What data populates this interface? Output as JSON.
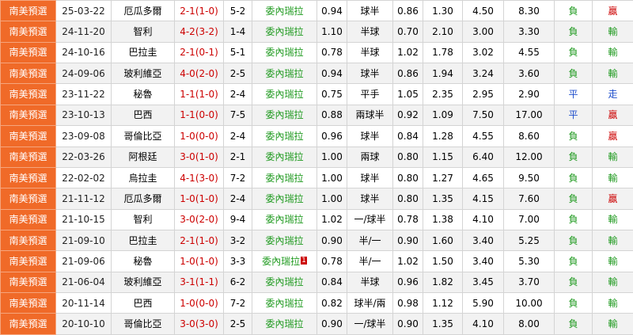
{
  "colors": {
    "league_bg": "#f06a28",
    "score": "#cc0000",
    "venezuela": "#1f9a1f",
    "win": "#cc0000",
    "lose": "#1f9a1f",
    "draw": "#1f4fcc"
  },
  "rows": [
    {
      "league": "南美預選",
      "date": "25-03-22",
      "opp": "厄瓜多爾",
      "score": "2-1(1-0)",
      "corner": "5-2",
      "team": "委內瑞拉",
      "red": "",
      "o1": "0.94",
      "hc": "球半",
      "o2": "0.86",
      "e1": "1.30",
      "e2": "4.50",
      "e3": "8.30",
      "wl": "負",
      "res": "贏"
    },
    {
      "league": "南美預選",
      "date": "24-11-20",
      "opp": "智利",
      "score": "4-2(3-2)",
      "corner": "1-4",
      "team": "委內瑞拉",
      "red": "",
      "o1": "1.10",
      "hc": "半球",
      "o2": "0.70",
      "e1": "2.10",
      "e2": "3.00",
      "e3": "3.30",
      "wl": "負",
      "res": "輸"
    },
    {
      "league": "南美預選",
      "date": "24-10-16",
      "opp": "巴拉圭",
      "score": "2-1(0-1)",
      "corner": "5-1",
      "team": "委內瑞拉",
      "red": "",
      "o1": "0.78",
      "hc": "半球",
      "o2": "1.02",
      "e1": "1.78",
      "e2": "3.02",
      "e3": "4.55",
      "wl": "負",
      "res": "輸"
    },
    {
      "league": "南美預選",
      "date": "24-09-06",
      "opp": "玻利維亞",
      "score": "4-0(2-0)",
      "corner": "2-5",
      "team": "委內瑞拉",
      "red": "",
      "o1": "0.94",
      "hc": "球半",
      "o2": "0.86",
      "e1": "1.94",
      "e2": "3.24",
      "e3": "3.60",
      "wl": "負",
      "res": "輸"
    },
    {
      "league": "南美預選",
      "date": "23-11-22",
      "opp": "秘魯",
      "score": "1-1(1-0)",
      "corner": "2-4",
      "team": "委內瑞拉",
      "red": "",
      "o1": "0.75",
      "hc": "平手",
      "o2": "1.05",
      "e1": "2.35",
      "e2": "2.95",
      "e3": "2.90",
      "wl": "平",
      "res": "走"
    },
    {
      "league": "南美預選",
      "date": "23-10-13",
      "opp": "巴西",
      "score": "1-1(0-0)",
      "corner": "7-5",
      "team": "委內瑞拉",
      "red": "",
      "o1": "0.88",
      "hc": "兩球半",
      "o2": "0.92",
      "e1": "1.09",
      "e2": "7.50",
      "e3": "17.00",
      "wl": "平",
      "res": "贏"
    },
    {
      "league": "南美預選",
      "date": "23-09-08",
      "opp": "哥倫比亞",
      "score": "1-0(0-0)",
      "corner": "2-4",
      "team": "委內瑞拉",
      "red": "",
      "o1": "0.96",
      "hc": "球半",
      "o2": "0.84",
      "e1": "1.28",
      "e2": "4.55",
      "e3": "8.60",
      "wl": "負",
      "res": "贏"
    },
    {
      "league": "南美預選",
      "date": "22-03-26",
      "opp": "阿根廷",
      "score": "3-0(1-0)",
      "corner": "2-1",
      "team": "委內瑞拉",
      "red": "",
      "o1": "1.00",
      "hc": "兩球",
      "o2": "0.80",
      "e1": "1.15",
      "e2": "6.40",
      "e3": "12.00",
      "wl": "負",
      "res": "輸"
    },
    {
      "league": "南美預選",
      "date": "22-02-02",
      "opp": "烏拉圭",
      "score": "4-1(3-0)",
      "corner": "7-2",
      "team": "委內瑞拉",
      "red": "",
      "o1": "1.00",
      "hc": "球半",
      "o2": "0.80",
      "e1": "1.27",
      "e2": "4.65",
      "e3": "9.50",
      "wl": "負",
      "res": "輸"
    },
    {
      "league": "南美預選",
      "date": "21-11-12",
      "opp": "厄瓜多爾",
      "score": "1-0(1-0)",
      "corner": "2-4",
      "team": "委內瑞拉",
      "red": "",
      "o1": "1.00",
      "hc": "球半",
      "o2": "0.80",
      "e1": "1.35",
      "e2": "4.15",
      "e3": "7.60",
      "wl": "負",
      "res": "贏"
    },
    {
      "league": "南美預選",
      "date": "21-10-15",
      "opp": "智利",
      "score": "3-0(2-0)",
      "corner": "9-4",
      "team": "委內瑞拉",
      "red": "",
      "o1": "1.02",
      "hc": "一/球半",
      "o2": "0.78",
      "e1": "1.38",
      "e2": "4.10",
      "e3": "7.00",
      "wl": "負",
      "res": "輸"
    },
    {
      "league": "南美預選",
      "date": "21-09-10",
      "opp": "巴拉圭",
      "score": "2-1(1-0)",
      "corner": "3-2",
      "team": "委內瑞拉",
      "red": "",
      "o1": "0.90",
      "hc": "半/一",
      "o2": "0.90",
      "e1": "1.60",
      "e2": "3.40",
      "e3": "5.25",
      "wl": "負",
      "res": "輸"
    },
    {
      "league": "南美預選",
      "date": "21-09-06",
      "opp": "秘魯",
      "score": "1-0(1-0)",
      "corner": "3-3",
      "team": "委內瑞拉",
      "red": "1",
      "o1": "0.78",
      "hc": "半/一",
      "o2": "1.02",
      "e1": "1.50",
      "e2": "3.40",
      "e3": "5.30",
      "wl": "負",
      "res": "輸"
    },
    {
      "league": "南美預選",
      "date": "21-06-04",
      "opp": "玻利維亞",
      "score": "3-1(1-1)",
      "corner": "6-2",
      "team": "委內瑞拉",
      "red": "",
      "o1": "0.84",
      "hc": "半球",
      "o2": "0.96",
      "e1": "1.82",
      "e2": "3.45",
      "e3": "3.70",
      "wl": "負",
      "res": "輸"
    },
    {
      "league": "南美預選",
      "date": "20-11-14",
      "opp": "巴西",
      "score": "1-0(0-0)",
      "corner": "7-2",
      "team": "委內瑞拉",
      "red": "",
      "o1": "0.82",
      "hc": "球半/兩",
      "o2": "0.98",
      "e1": "1.12",
      "e2": "5.90",
      "e3": "10.00",
      "wl": "負",
      "res": "輸"
    },
    {
      "league": "南美預選",
      "date": "20-10-10",
      "opp": "哥倫比亞",
      "score": "3-0(3-0)",
      "corner": "2-5",
      "team": "委內瑞拉",
      "red": "",
      "o1": "0.90",
      "hc": "一/球半",
      "o2": "0.90",
      "e1": "1.35",
      "e2": "4.10",
      "e3": "8.00",
      "wl": "負",
      "res": "輸"
    }
  ]
}
